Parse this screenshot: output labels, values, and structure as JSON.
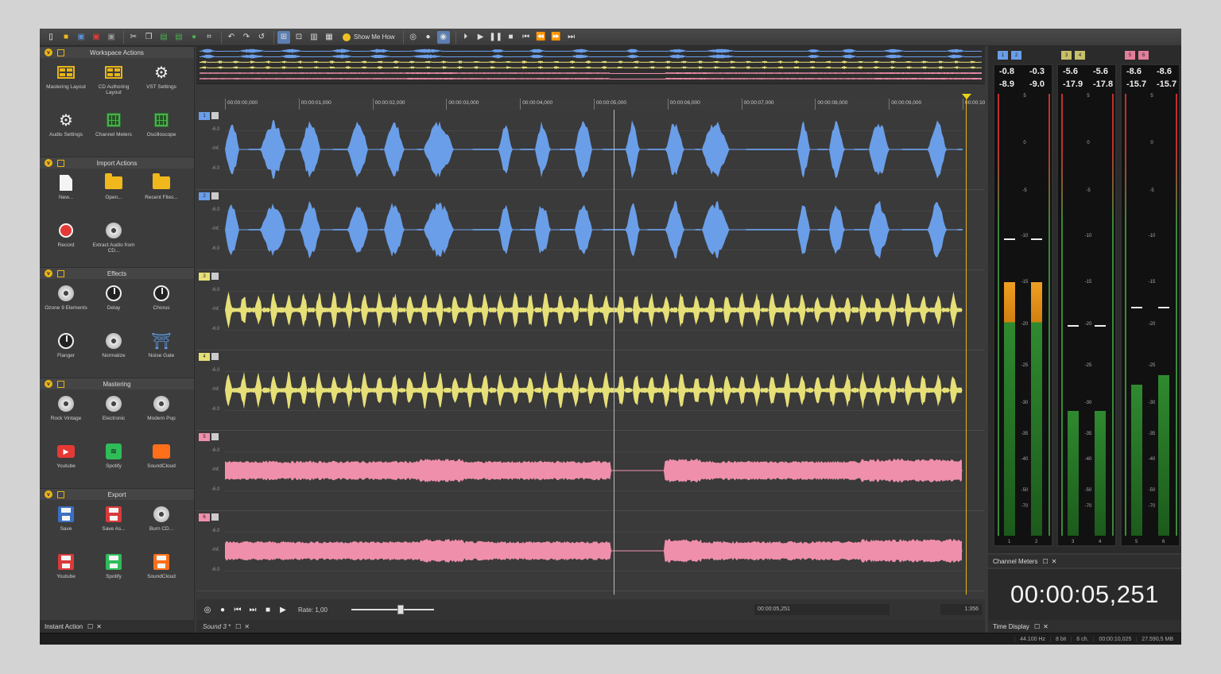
{
  "toolbar": {
    "show_me_how": "Show Me How"
  },
  "left_panel": {
    "sections": [
      {
        "title": "Workspace Actions",
        "items": [
          "Mastering Layout",
          "CD Authoring Layout",
          "VST Settings",
          "Audio Settings",
          "Channel Meters",
          "Oscilloscope"
        ]
      },
      {
        "title": "Import Actions",
        "items": [
          "New...",
          "Open...",
          "Recent Files...",
          "Record",
          "Extract Audio from CD..."
        ]
      },
      {
        "title": "Effects",
        "items": [
          "Ozone 9 Elements",
          "Delay",
          "Chorus",
          "Flanger",
          "Normalize",
          "Noise Gate"
        ]
      },
      {
        "title": "Mastering",
        "items": [
          "Rock Vintage",
          "Electronic",
          "Modern Pop",
          "Youtube",
          "Spotify",
          "SoundCloud"
        ]
      },
      {
        "title": "Export",
        "items": [
          "Save",
          "Save As...",
          "Burn CD...",
          "Youtube",
          "Spotify",
          "SoundCloud"
        ]
      }
    ],
    "footer": "Instant Action"
  },
  "ruler": {
    "ticks": [
      "00:00:00,000",
      "00:00:01,000",
      "00:00:02,000",
      "00:00:03,000",
      "00:00:04,000",
      "00:00:05,000",
      "00:00:06,000",
      "00:00:07,000",
      "00:00:08,000",
      "00:00:09,000",
      "00:00:10"
    ]
  },
  "tracks": [
    {
      "num": "1",
      "color": "#6a9ee8",
      "db_top": "-6.0",
      "db_mid": "-Inf.",
      "db_bot": "-6.0"
    },
    {
      "num": "2",
      "color": "#6a9ee8",
      "db_top": "-6.0",
      "db_mid": "-Inf.",
      "db_bot": "-6.0"
    },
    {
      "num": "3",
      "color": "#e6df77",
      "db_top": "-6.0",
      "db_mid": "-Inf.",
      "db_bot": "-6.0"
    },
    {
      "num": "4",
      "color": "#e6df77",
      "db_top": "-6.0",
      "db_mid": "-Inf.",
      "db_bot": "-6.0"
    },
    {
      "num": "5",
      "color": "#ef8fab",
      "db_top": "-6.0",
      "db_mid": "-Inf.",
      "db_bot": "-6.0"
    },
    {
      "num": "6",
      "color": "#ef8fab",
      "db_top": "-6.0",
      "db_mid": "-Inf.",
      "db_bot": "-6.0"
    }
  ],
  "transport": {
    "rate_label": "Rate: 1,00",
    "rate_value": 1.0,
    "position": "00:00:05,251",
    "zoom": "1:356"
  },
  "document_tab": "Sound 3 *",
  "meters": {
    "groups": [
      {
        "channels": [
          "1",
          "2"
        ],
        "color": "#6a9ee8",
        "peak": [
          "-0.8",
          "-0.3"
        ],
        "rms": [
          "-8.9",
          "-9.0"
        ],
        "level": [
          0.57,
          0.57
        ]
      },
      {
        "channels": [
          "3",
          "4"
        ],
        "color": "#c7c06a",
        "peak": [
          "-5.6",
          "-5.6"
        ],
        "rms": [
          "-17.9",
          "-17.8"
        ],
        "level": [
          0.28,
          0.28
        ]
      },
      {
        "channels": [
          "5",
          "6"
        ],
        "color": "#e37f9a",
        "peak": [
          "-8.6",
          "-8.6"
        ],
        "rms": [
          "-15.7",
          "-15.7"
        ],
        "level": [
          0.34,
          0.36
        ]
      }
    ],
    "scale": [
      "5",
      "0",
      "-5",
      "-10",
      "-15",
      "-20",
      "-25",
      "-30",
      "-35",
      "-40",
      "-50",
      "-70"
    ],
    "footer": "Channel Meters"
  },
  "time_display": {
    "value": "00:00:05,251",
    "footer": "Time Display"
  },
  "status": {
    "sample_rate": "44.100 Hz",
    "bit_depth": "8 bit",
    "channels": "6 ch.",
    "length": "00:00:10,025",
    "size": "27.590,5 MB"
  }
}
